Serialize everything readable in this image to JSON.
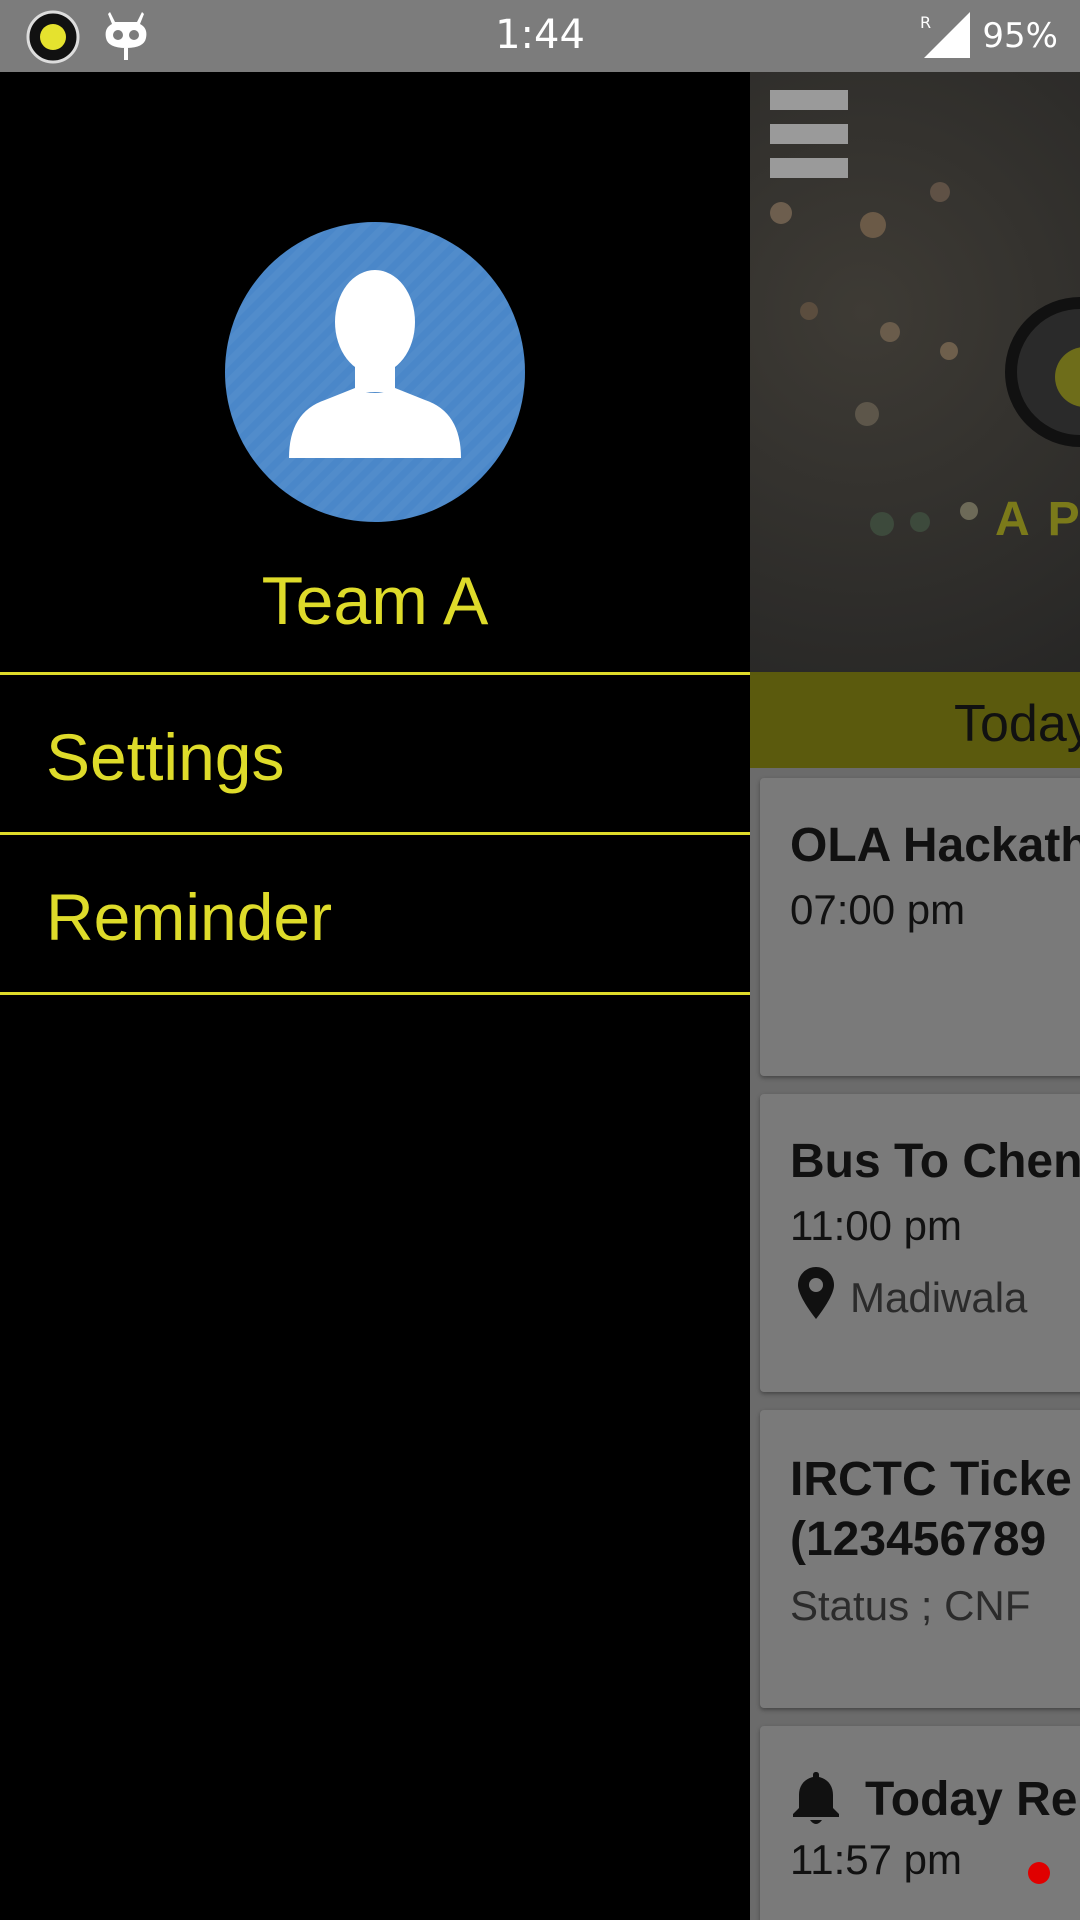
{
  "status_bar": {
    "time": "1:44",
    "battery_percent": "95%",
    "icons": [
      "app-logo-icon",
      "robot-icon",
      "signal-icon"
    ],
    "roaming_marker": "R"
  },
  "drawer": {
    "username": "Team A",
    "items": [
      {
        "label": "Settings"
      },
      {
        "label": "Reminder"
      }
    ],
    "accent_color": "#dedb2a",
    "avatar_color": "#4a87c9"
  },
  "main": {
    "hero_text": "AP",
    "date_label": "Today",
    "cards": [
      {
        "title": "OLA Hackath",
        "time": "07:00 pm"
      },
      {
        "title": "Bus To Chen",
        "time": "11:00 pm",
        "location": "Madiwala"
      },
      {
        "title": "IRCTC Ticke",
        "subtitle": "(123456789",
        "status": "Status ; CNF"
      },
      {
        "title": "Today Re",
        "time": "11:57 pm"
      }
    ]
  }
}
